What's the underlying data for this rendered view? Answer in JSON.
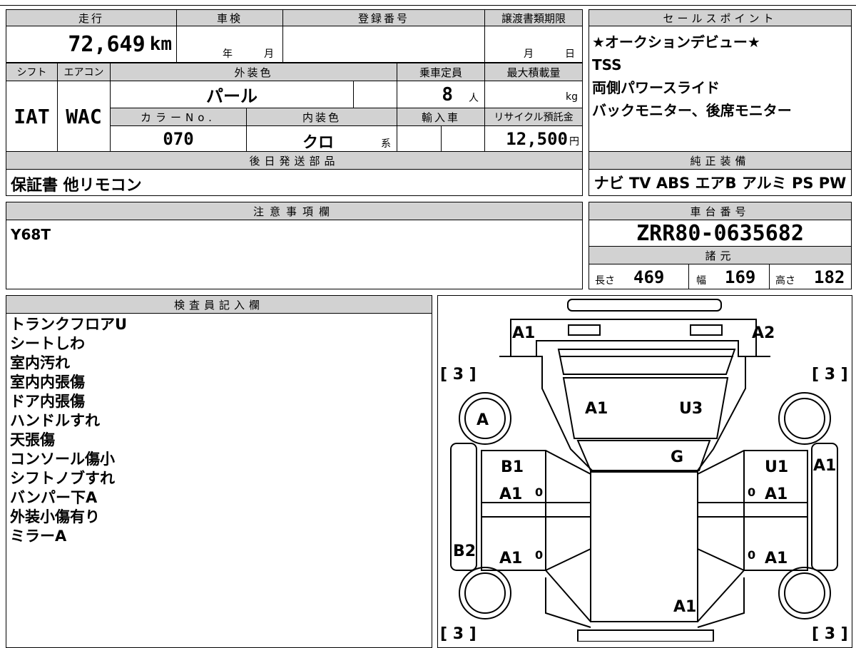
{
  "top": {
    "mileage": {
      "label": "走行",
      "value": "72,649",
      "unit": "km"
    },
    "inspection": {
      "label": "車検",
      "year_unit": "年",
      "month_unit": "月"
    },
    "registration": {
      "label": "登録番号"
    },
    "transfer": {
      "label": "譲渡書類期限",
      "month_unit": "月",
      "day_unit": "日"
    },
    "shift": {
      "label": "シフト",
      "value": "IAT"
    },
    "aircon": {
      "label": "エアコン",
      "value": "WAC"
    },
    "exterior_color": {
      "label": "外装色",
      "value": "パール"
    },
    "capacity": {
      "label": "乗車定員",
      "value": "8",
      "unit": "人"
    },
    "max_load": {
      "label": "最大積載量",
      "unit": "kg"
    },
    "color_no": {
      "label": "カラーNo.",
      "value": "070"
    },
    "interior_color": {
      "label": "内装色",
      "value": "クロ",
      "unit": "系"
    },
    "import": {
      "label": "輸入車"
    },
    "recycle": {
      "label": "リサイクル預託金",
      "value": "12,500",
      "unit": "円"
    },
    "accessories": {
      "label": "後日発送部品",
      "value": "保証書 他リモコン"
    }
  },
  "sales_points": {
    "label": "セールスポイント",
    "lines": [
      "★オークションデビュー★",
      "TSS",
      "両側パワースライド",
      "バックモニター、後席モニター"
    ]
  },
  "equipment": {
    "label": "純正装備",
    "value": "ナビ TV ABS エアB アルミ PS PW"
  },
  "notes": {
    "label": "注意事項欄",
    "value": "Y68T"
  },
  "chassis": {
    "label": "車台番号",
    "value": "ZRR80-0635682"
  },
  "specs": {
    "label": "諸元",
    "length_label": "長さ",
    "length": "469",
    "width_label": "幅",
    "width": "169",
    "height_label": "高さ",
    "height": "182"
  },
  "inspector": {
    "label": "検査員記入欄",
    "lines": [
      "トランクフロアU",
      "シートしわ",
      "室内汚れ",
      "室内内張傷",
      "ドア内張傷",
      "ハンドルすれ",
      "天張傷",
      "コンソール傷小",
      "シフトノブすれ",
      "バンパー下A",
      "外装小傷有り",
      "ミラーA"
    ]
  },
  "diagram": {
    "marks": {
      "tl": "A1",
      "tr": "A2",
      "windshield_l": "A1",
      "windshield_r": "U3",
      "roof": "G",
      "front_wheel": "A",
      "front_door_l_top": "B1",
      "front_door_l_bot": "A1",
      "front_door_r_top": "U1",
      "front_door_r_bot": "A1",
      "fender_r": "A1",
      "rear_door_l": "A1",
      "rear_door_r": "A1",
      "rear_quarter_l": "B2",
      "rear": "A1",
      "bracket_tl": "[ 3 ]",
      "bracket_tr": "[ 3 ]",
      "bracket_bl": "[ 3 ]",
      "bracket_br": "[ 3 ]",
      "zero": "0"
    }
  }
}
